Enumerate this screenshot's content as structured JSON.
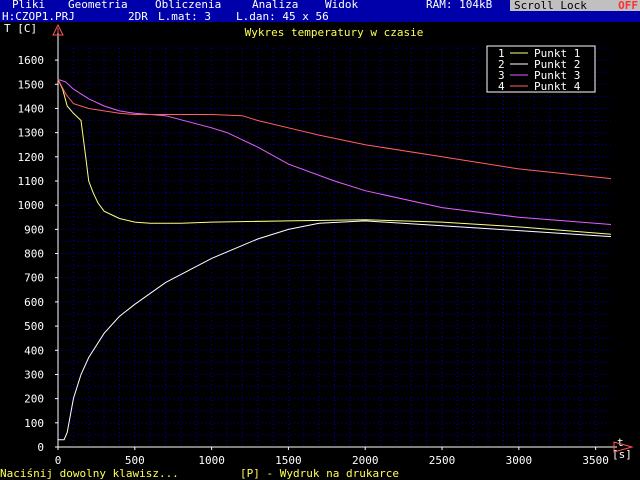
{
  "menu": {
    "items": [
      "Pliki",
      "Geometria",
      "Obliczenia",
      "Analiza",
      "Widok"
    ],
    "ram": "RAM: 104kB",
    "scroll_lock": "Scroll Lock",
    "scroll_lock_state": "OFF"
  },
  "status": {
    "project": "H:CZOP1.PRJ",
    "mode": "2DR",
    "materials": "L.mat: 3",
    "dims": "L.dan: 45 x 56"
  },
  "footer": {
    "hint": "Naciśnij dowolny klawisz...",
    "print_hint": "[P] - Wydruk na drukarce"
  },
  "colors": {
    "background": "#000000",
    "axis": "#ffffff",
    "grid": "#0000aa",
    "title": "#ffff55",
    "arrow": "#ff5555"
  },
  "chart_data": {
    "type": "line",
    "title": "Wykres temperatury w czasie",
    "ylabel": "T [C]",
    "xlabel": "t [s]",
    "xlim": [
      0,
      3600
    ],
    "ylim": [
      0,
      1650
    ],
    "xticks": [
      0,
      500,
      1000,
      1500,
      2000,
      2500,
      3000,
      3500
    ],
    "yticks": [
      0,
      100,
      200,
      300,
      400,
      500,
      600,
      700,
      800,
      900,
      1000,
      1100,
      1200,
      1300,
      1400,
      1500,
      1600
    ],
    "grid": true,
    "legend_position": "top-right",
    "series": [
      {
        "name": "1   Punkt  1",
        "color": "#ffff80",
        "x": [
          0,
          30,
          60,
          100,
          150,
          180,
          200,
          230,
          260,
          300,
          400,
          500,
          600,
          700,
          800,
          1000,
          1500,
          2000,
          2500,
          3000,
          3600
        ],
        "y": [
          1520,
          1480,
          1410,
          1380,
          1350,
          1200,
          1100,
          1050,
          1010,
          975,
          945,
          930,
          925,
          925,
          925,
          930,
          935,
          940,
          930,
          910,
          880
        ]
      },
      {
        "name": "2   Punkt  2",
        "color": "#ffffff",
        "x": [
          0,
          40,
          60,
          100,
          150,
          200,
          300,
          400,
          500,
          700,
          1000,
          1300,
          1500,
          1700,
          2000,
          2500,
          3000,
          3600
        ],
        "y": [
          30,
          30,
          60,
          200,
          300,
          370,
          470,
          540,
          590,
          680,
          780,
          860,
          900,
          925,
          935,
          915,
          895,
          870
        ]
      },
      {
        "name": "3   Punkt  3",
        "color": "#e060ff",
        "x": [
          0,
          50,
          100,
          200,
          300,
          400,
          500,
          700,
          1000,
          1100,
          1300,
          1500,
          1800,
          2000,
          2500,
          3000,
          3600
        ],
        "y": [
          1520,
          1510,
          1480,
          1440,
          1410,
          1390,
          1380,
          1370,
          1320,
          1300,
          1240,
          1170,
          1100,
          1060,
          990,
          950,
          920
        ]
      },
      {
        "name": "4   Punkt  4",
        "color": "#ff6060",
        "x": [
          0,
          50,
          100,
          200,
          300,
          400,
          500,
          700,
          1000,
          1200,
          1300,
          1500,
          1700,
          2000,
          2500,
          3000,
          3600
        ],
        "y": [
          1520,
          1460,
          1420,
          1400,
          1390,
          1380,
          1375,
          1375,
          1375,
          1370,
          1350,
          1320,
          1290,
          1250,
          1200,
          1150,
          1110
        ]
      }
    ]
  }
}
